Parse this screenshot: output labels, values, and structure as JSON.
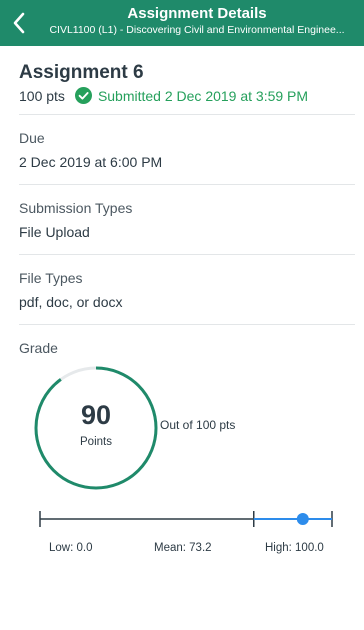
{
  "nav": {
    "title": "Assignment Details",
    "subtitle": "CIVL1100 (L1) - Discovering Civil and Environmental Enginee..."
  },
  "assignment": {
    "name": "Assignment 6",
    "points": "100 pts",
    "status": "Submitted 2 Dec 2019 at 3:59 PM"
  },
  "due": {
    "label": "Due",
    "value": "2 Dec 2019 at 6:00 PM"
  },
  "submission_types": {
    "label": "Submission Types",
    "value": "File Upload"
  },
  "file_types": {
    "label": "File Types",
    "value": "pdf, doc, or docx"
  },
  "grade": {
    "label": "Grade",
    "score": "90",
    "unit": "Points",
    "out_of": "Out of 100 pts",
    "fraction": 0.9,
    "stats": {
      "low_label": "Low: 0.0",
      "mean_label": "Mean: 73.2",
      "high_label": "High: 100.0",
      "low": 0,
      "mean": 73.2,
      "high": 100,
      "score": 90
    }
  },
  "colors": {
    "brand": "#1f8a6a",
    "success": "#26a05c",
    "score_marker": "#2d8ceb",
    "text": "#2d3b45"
  },
  "icons": {
    "back": "chevron-left-icon",
    "status": "check-circle-icon"
  }
}
